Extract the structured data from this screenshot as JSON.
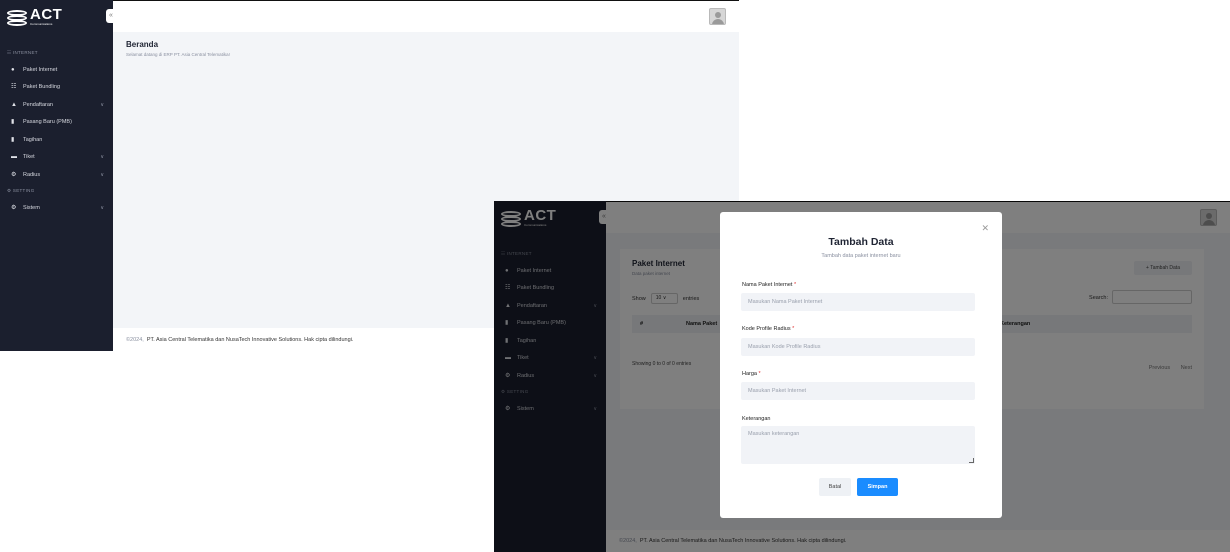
{
  "brand": {
    "name": "ACT",
    "tagline": "Communications"
  },
  "sidebar": {
    "section_internet": "INTERNET",
    "section_setting": "SETTING",
    "items": [
      {
        "label": "Paket Internet",
        "icon": "globe-icon"
      },
      {
        "label": "Paket Bundling",
        "icon": "network-icon"
      },
      {
        "label": "Pendaftaran",
        "icon": "user-icon",
        "has_children": true
      },
      {
        "label": "Pasang Baru (PMB)",
        "icon": "document-icon"
      },
      {
        "label": "Tagihan",
        "icon": "document-icon"
      },
      {
        "label": "Tiket",
        "icon": "ticket-icon",
        "has_children": true
      },
      {
        "label": "Radius",
        "icon": "gears-icon",
        "has_children": true
      }
    ],
    "settings_items": [
      {
        "label": "Sistem",
        "icon": "gears-icon",
        "has_children": true
      }
    ]
  },
  "dashboard": {
    "title": "Beranda",
    "subtitle": "Selamat datang di ERP PT. Asia Central Telematika!"
  },
  "footer": {
    "year": "©2024,",
    "text": "PT. Asia Central Telematika dan NusaTech Innovative Solutions. Hak cipta dilindungi."
  },
  "paket_page": {
    "title": "Paket Internet",
    "subtitle": "Data paket internet",
    "add_button": "+ Tambah Data",
    "show_label": "Show",
    "entries_value": "10",
    "entries_label": "entries",
    "search_label": "Search:",
    "columns": [
      "#",
      "Nama Paket",
      "Keterangan"
    ],
    "showing": "Showing 0 to 0 of 0 entries",
    "prev": "Previous",
    "next": "Next"
  },
  "modal": {
    "title": "Tambah Data",
    "subtitle": "Tambah data paket internet baru",
    "fields": [
      {
        "label": "Nama Paket Internet",
        "required": true,
        "placeholder": "Masukan Nama Paket Internet"
      },
      {
        "label": "Kode Profile Radius",
        "required": true,
        "placeholder": "Masukan Kode Profile Radius"
      },
      {
        "label": "Harga",
        "required": true,
        "placeholder": "Masukan Paket Internet"
      },
      {
        "label": "Keterangan",
        "required": false,
        "placeholder": "Masukan keterangan"
      }
    ],
    "cancel_label": "Batal",
    "save_label": "Simpan",
    "required_mark": "*"
  },
  "colors": {
    "sidebar_bg": "#1b1f2e",
    "primary": "#1a8cff",
    "content_bg": "#f3f5f8"
  }
}
